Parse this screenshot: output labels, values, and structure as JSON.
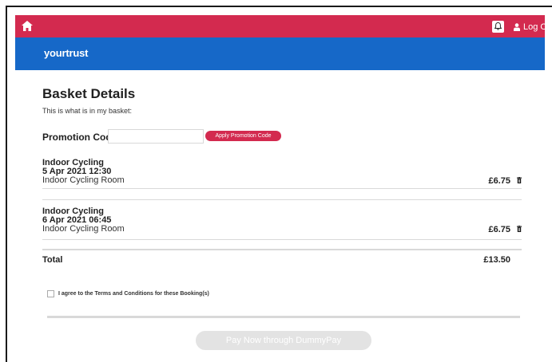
{
  "header": {
    "logout_label": "Log Out",
    "brand": "yourtrust"
  },
  "basket": {
    "title": "Basket Details",
    "subtitle": "This is what is in my basket:",
    "promo_label": "Promotion Code:",
    "promo_value": "",
    "promo_button": "Apply Promotion Code",
    "items": [
      {
        "name": "Indoor Cycling",
        "datetime": "5 Apr 2021 12:30",
        "location": "Indoor Cycling Room",
        "price": "£6.75"
      },
      {
        "name": "Indoor Cycling",
        "datetime": "6 Apr 2021 06:45",
        "location": "Indoor Cycling Room",
        "price": "£6.75"
      }
    ],
    "total_label": "Total",
    "total_value": "£13.50",
    "terms_label": "I agree to the Terms and Conditions for these Booking(s)",
    "pay_button": "Pay Now through DummyPay"
  },
  "colors": {
    "topbar": "#d32a4f",
    "brandbar": "#1668c8",
    "accent": "#d32a4f"
  },
  "icons": {
    "home": "home-icon",
    "bell": "bell-icon",
    "user": "user-icon",
    "trash": "trash-icon"
  }
}
